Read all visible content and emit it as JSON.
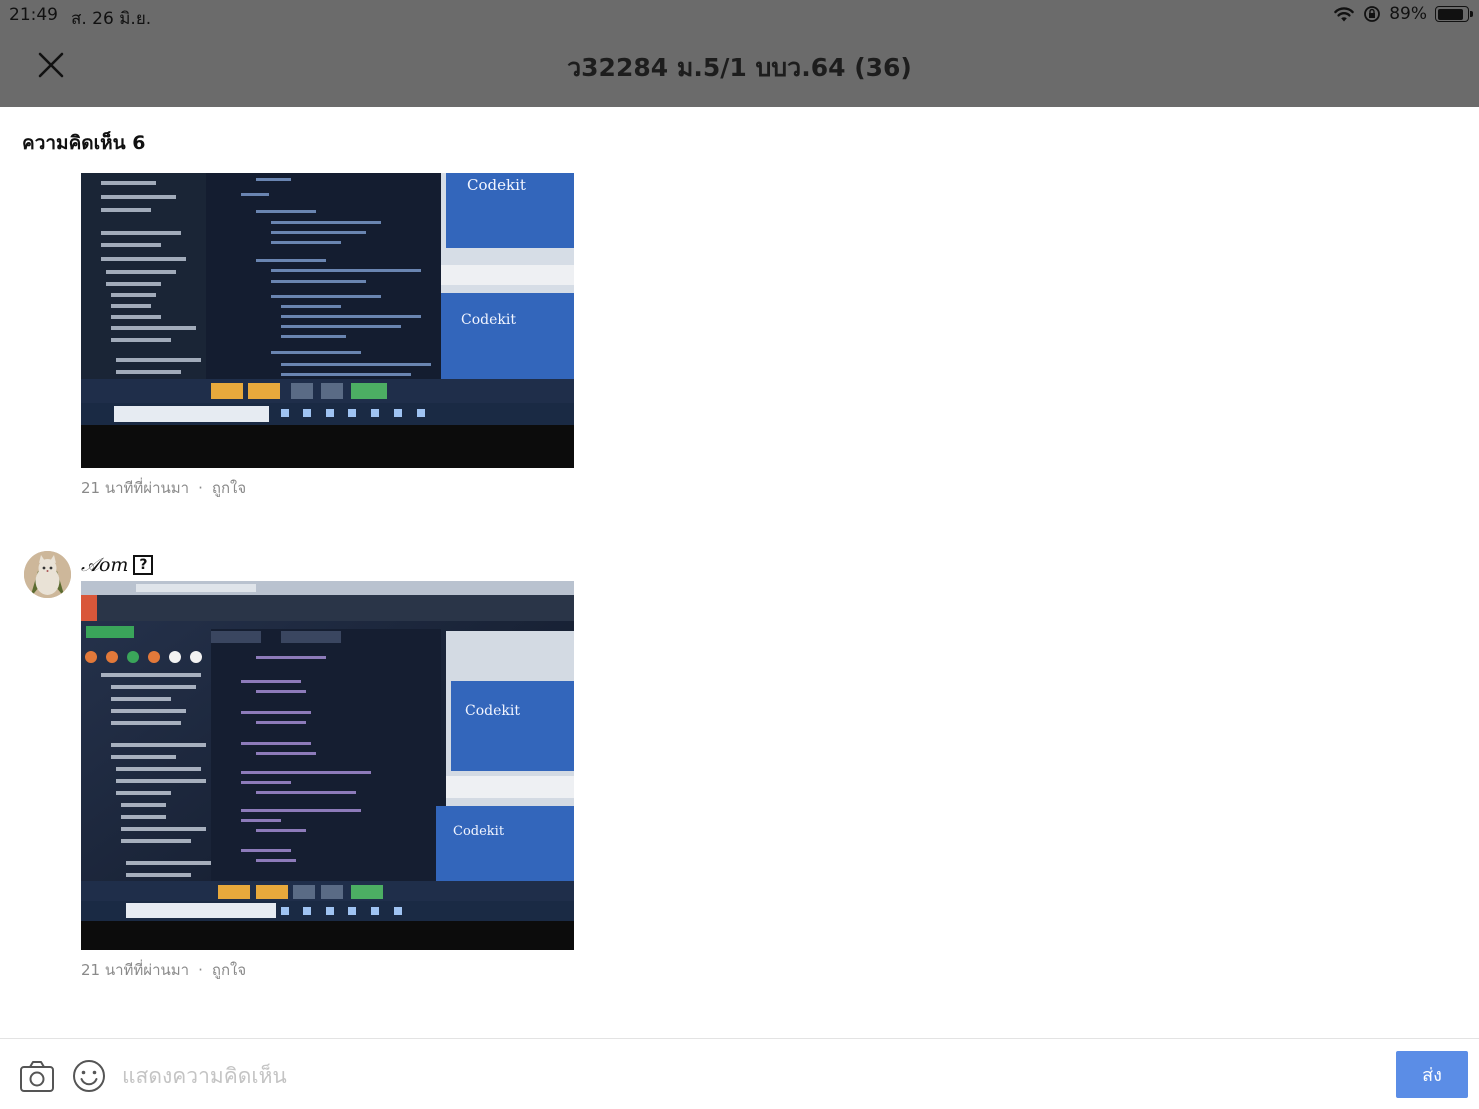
{
  "status_bar": {
    "time": "21:49",
    "date": "ส. 26 มิ.ย.",
    "battery": "89%",
    "battery_level": 0.89
  },
  "header": {
    "title": "ว32284 ม.5/1 บบว.64 (36)",
    "close_icon": "close-icon"
  },
  "comments": {
    "heading": "ความคิดเห็น 6",
    "items": [
      {
        "author": "",
        "image": "screenshot-photo-code-editor",
        "photo_labels": [
          "Codekit",
          "Codekit"
        ],
        "time": "21 นาทีที่ผ่านมา",
        "separator": "·",
        "like": "ถูกใจ"
      },
      {
        "author": "𝒜𝑜𝑚",
        "author_badge": "?",
        "avatar": "cat-avatar",
        "image": "screenshot-photo-code-editor",
        "photo_labels": [
          "Codekit",
          "Codekit"
        ],
        "time": "21 นาทีที่ผ่านมา",
        "separator": "·",
        "like": "ถูกใจ"
      }
    ]
  },
  "composer": {
    "placeholder": "แสดงความคิดเห็น",
    "send_label": "ส่ง",
    "camera_icon": "camera-icon",
    "emoji_icon": "emoji-icon"
  },
  "colors": {
    "header_bg": "#6b6b6b",
    "send_button": "#5b8de6",
    "meta_text": "#8a8a8a"
  }
}
